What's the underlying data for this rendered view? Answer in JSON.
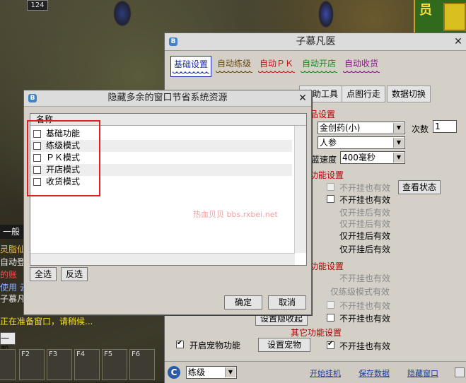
{
  "game": {
    "level": "124",
    "minimap_glyph": "员",
    "chat_tab": "一般",
    "chat_lines": [
      "灵脂仙",
      "自动登",
      "的账",
      "使用 云",
      "子慕凡"
    ],
    "status_line": "正在准备窗口，请稍候...",
    "chat_tab2": "一般",
    "hotbar_keys": [
      "",
      "F2",
      "F3",
      "F4",
      "F5",
      "F6",
      ""
    ]
  },
  "main_window": {
    "title": "子慕凡医",
    "icon": "B",
    "tabs": [
      {
        "label": "基础设置",
        "wave_color": "#1a2ab0"
      },
      {
        "label": "自动练级",
        "wave_color": "#6b4a10"
      },
      {
        "label": "自动ＰＫ",
        "wave_color": "#c01818"
      },
      {
        "label": "自动开店",
        "wave_color": "#1a8a1a"
      },
      {
        "label": "自动收货",
        "wave_color": "#8a188a"
      }
    ],
    "subtabs": [
      "辅助工具",
      "点图行走",
      "数据切换"
    ],
    "sections": {
      "s1_title": "品设置",
      "medicine_select": "金创药(小)",
      "count_label": "次数",
      "count_value": "1",
      "item_select": "人参",
      "speed_label": "蓝速度",
      "speed_select": "400毫秒",
      "s2_title": "功能设置",
      "s2_rows": [
        "不开挂也有效",
        "不开挂也有效",
        "仅开挂后有效",
        "仅开挂后有效",
        "仅开挂后有效",
        "仅开挂后有效"
      ],
      "view_status_button": "查看状态",
      "s3_title": "功能设置",
      "s3_rows": [
        "不开挂也有效",
        "仅练级模式有效",
        "不开挂也有效",
        "不开挂也有效"
      ],
      "hidden_button": "设置隐收起",
      "s4_title": "其它功能设置",
      "pet_label": "开启宠物功能",
      "pet_button": "设置宠物",
      "pet_effective": "不开挂也有效"
    },
    "bottom": {
      "mode_select": "练级",
      "link_start": "开始挂机",
      "link_save": "保存数据",
      "link_hide": "隐藏窗口"
    }
  },
  "dialog": {
    "title": "隐藏多余的窗口节省系统资源",
    "icon": "B",
    "header": "名称",
    "items": [
      "基础功能",
      "练级模式",
      "ＰＫ模式",
      "开店模式",
      "收货模式"
    ],
    "watermark": "热血贝贝 bbs.rxbei.net",
    "select_all": "全选",
    "invert": "反选",
    "ok": "确定",
    "cancel": "取消"
  }
}
